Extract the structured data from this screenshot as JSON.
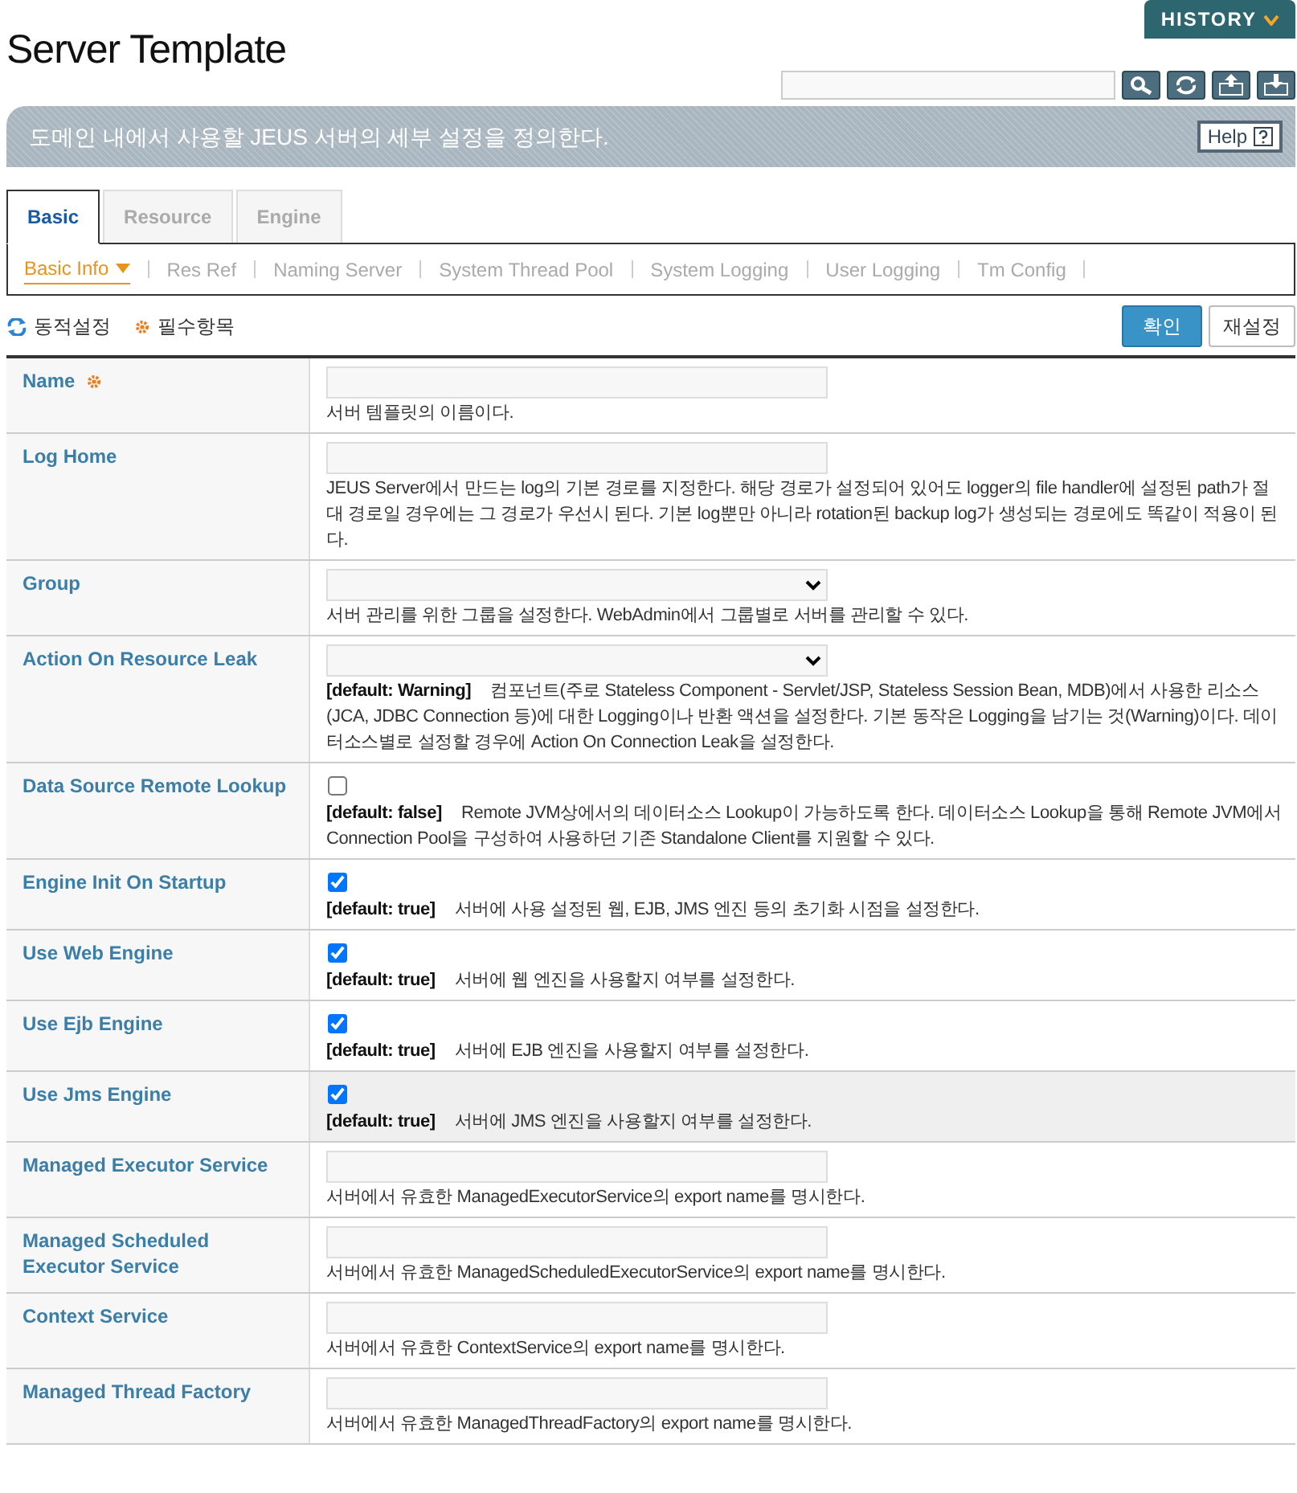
{
  "header": {
    "title": "Server Template",
    "history_button": "HISTORY"
  },
  "banner": {
    "text": "도메인 내에서 사용할 JEUS 서버의 세부 설정을 정의한다.",
    "help": "Help"
  },
  "tabs": [
    {
      "label": "Basic",
      "selected": true
    },
    {
      "label": "Resource",
      "selected": false
    },
    {
      "label": "Engine",
      "selected": false
    }
  ],
  "subtabs": [
    {
      "label": "Basic Info",
      "selected": true
    },
    {
      "label": "Res Ref",
      "selected": false
    },
    {
      "label": "Naming Server",
      "selected": false
    },
    {
      "label": "System Thread Pool",
      "selected": false
    },
    {
      "label": "System Logging",
      "selected": false
    },
    {
      "label": "User Logging",
      "selected": false
    },
    {
      "label": "Tm Config",
      "selected": false
    }
  ],
  "legend": {
    "dynamic": "동적설정",
    "required": "필수항목"
  },
  "buttons": {
    "confirm": "확인",
    "reset": "재설정"
  },
  "fields": [
    {
      "label": "Name",
      "kind": "text",
      "required": true,
      "highlighted": false,
      "description": "서버 템플릿의 이름이다."
    },
    {
      "label": "Log Home",
      "kind": "text",
      "required": false,
      "highlighted": false,
      "description": "JEUS Server에서 만드는 log의 기본 경로를 지정한다. 해당 경로가 설정되어 있어도 logger의 file handler에 설정된 path가 절대 경로일 경우에는 그 경로가 우선시 된다. 기본 log뿐만 아니라 rotation된 backup log가 생성되는 경로에도 똑같이 적용이 된다."
    },
    {
      "label": "Group",
      "kind": "select",
      "required": false,
      "highlighted": false,
      "description": "서버 관리를 위한 그룹을 설정한다. WebAdmin에서 그룹별로 서버를 관리할 수 있다."
    },
    {
      "label": "Action On Resource Leak",
      "kind": "select",
      "required": false,
      "highlighted": false,
      "default": "[default: Warning]",
      "description": "컴포넌트(주로 Stateless Component - Servlet/JSP, Stateless Session Bean, MDB)에서 사용한 리소스(JCA, JDBC Connection 등)에 대한 Logging이나 반환 액션을 설정한다. 기본 동작은 Logging을 남기는 것(Warning)이다. 데이터소스별로 설정할 경우에 Action On Connection Leak을 설정한다."
    },
    {
      "label": "Data Source Remote Lookup",
      "kind": "checkbox",
      "checked": false,
      "required": false,
      "highlighted": false,
      "default": "[default: false]",
      "description": "Remote JVM상에서의 데이터소스 Lookup이 가능하도록 한다. 데이터소스 Lookup을 통해 Remote JVM에서 Connection Pool을 구성하여 사용하던 기존 Standalone Client를 지원할 수 있다."
    },
    {
      "label": "Engine Init On Startup",
      "kind": "checkbox",
      "checked": true,
      "required": false,
      "highlighted": false,
      "default": "[default: true]",
      "description": "서버에 사용 설정된 웹, EJB, JMS 엔진 등의 초기화 시점을 설정한다."
    },
    {
      "label": "Use Web Engine",
      "kind": "checkbox",
      "checked": true,
      "required": false,
      "highlighted": false,
      "default": "[default: true]",
      "description": "서버에 웹 엔진을 사용할지 여부를 설정한다."
    },
    {
      "label": "Use Ejb Engine",
      "kind": "checkbox",
      "checked": true,
      "required": false,
      "highlighted": false,
      "default": "[default: true]",
      "description": "서버에 EJB 엔진을 사용할지 여부를 설정한다."
    },
    {
      "label": "Use Jms Engine",
      "kind": "checkbox",
      "checked": true,
      "required": false,
      "highlighted": true,
      "default": "[default: true]",
      "description": "서버에 JMS 엔진을 사용할지 여부를 설정한다."
    },
    {
      "label": "Managed Executor Service",
      "kind": "text",
      "required": false,
      "highlighted": false,
      "description": "서버에서 유효한 ManagedExecutorService의 export name를 명시한다."
    },
    {
      "label": "Managed Scheduled Executor Service",
      "kind": "text",
      "required": false,
      "highlighted": false,
      "description": "서버에서 유효한 ManagedScheduledExecutorService의 export name를 명시한다."
    },
    {
      "label": "Context Service",
      "kind": "text",
      "required": false,
      "highlighted": false,
      "description": "서버에서 유효한 ContextService의 export name를 명시한다."
    },
    {
      "label": "Managed Thread Factory",
      "kind": "text",
      "required": false,
      "highlighted": false,
      "description": "서버에서 유효한 ManagedThreadFactory의 export name를 명시한다."
    }
  ]
}
